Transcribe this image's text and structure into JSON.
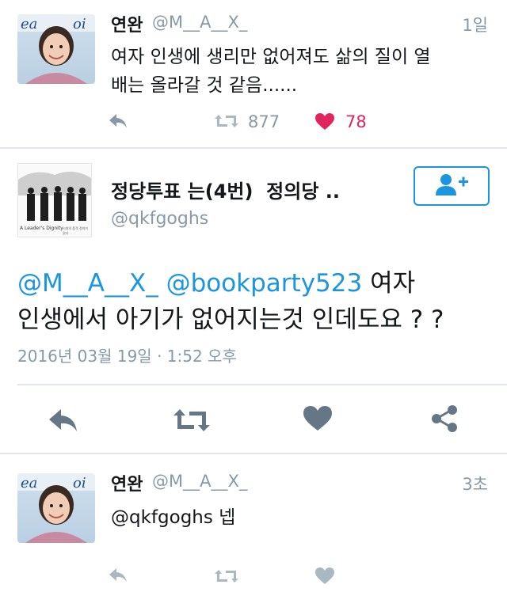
{
  "tweet1": {
    "display_name": "연완",
    "handle": "@M__A__X_",
    "time": "1일",
    "text_line1": "여자 인생에 생리만 없어져도 삶의 질이 열",
    "text_line2": "배는 올라갈 것 같음......",
    "retweet_count": "877",
    "like_count": "78"
  },
  "main_tweet": {
    "display_name": "정당투표 는(4번)  정의당 ..",
    "handle": "@qkfgoghs",
    "mention1": "@M__A__X_",
    "mention2": "@bookparty523",
    "text_tail": "여자",
    "text_line2": "인생에서 아기가 없어지는것 인데도요 ? ?",
    "timestamp": "2016년 03월 19일 · 1:52 오후",
    "avatar_caption": "A Leader's Dignity",
    "avatar_caption_right": "시대의 품격 정의가 있다"
  },
  "tweet3": {
    "display_name": "연완",
    "handle": "@M__A__X_",
    "time": "3초",
    "mention": "@qkfgoghs",
    "reply": "넵"
  },
  "colors": {
    "accent": "#1b95e0",
    "like": "#e0245e",
    "muted": "#8899a6"
  },
  "icons": [
    "reply-icon",
    "retweet-icon",
    "heart-icon",
    "share-icon",
    "follow-user-icon"
  ]
}
